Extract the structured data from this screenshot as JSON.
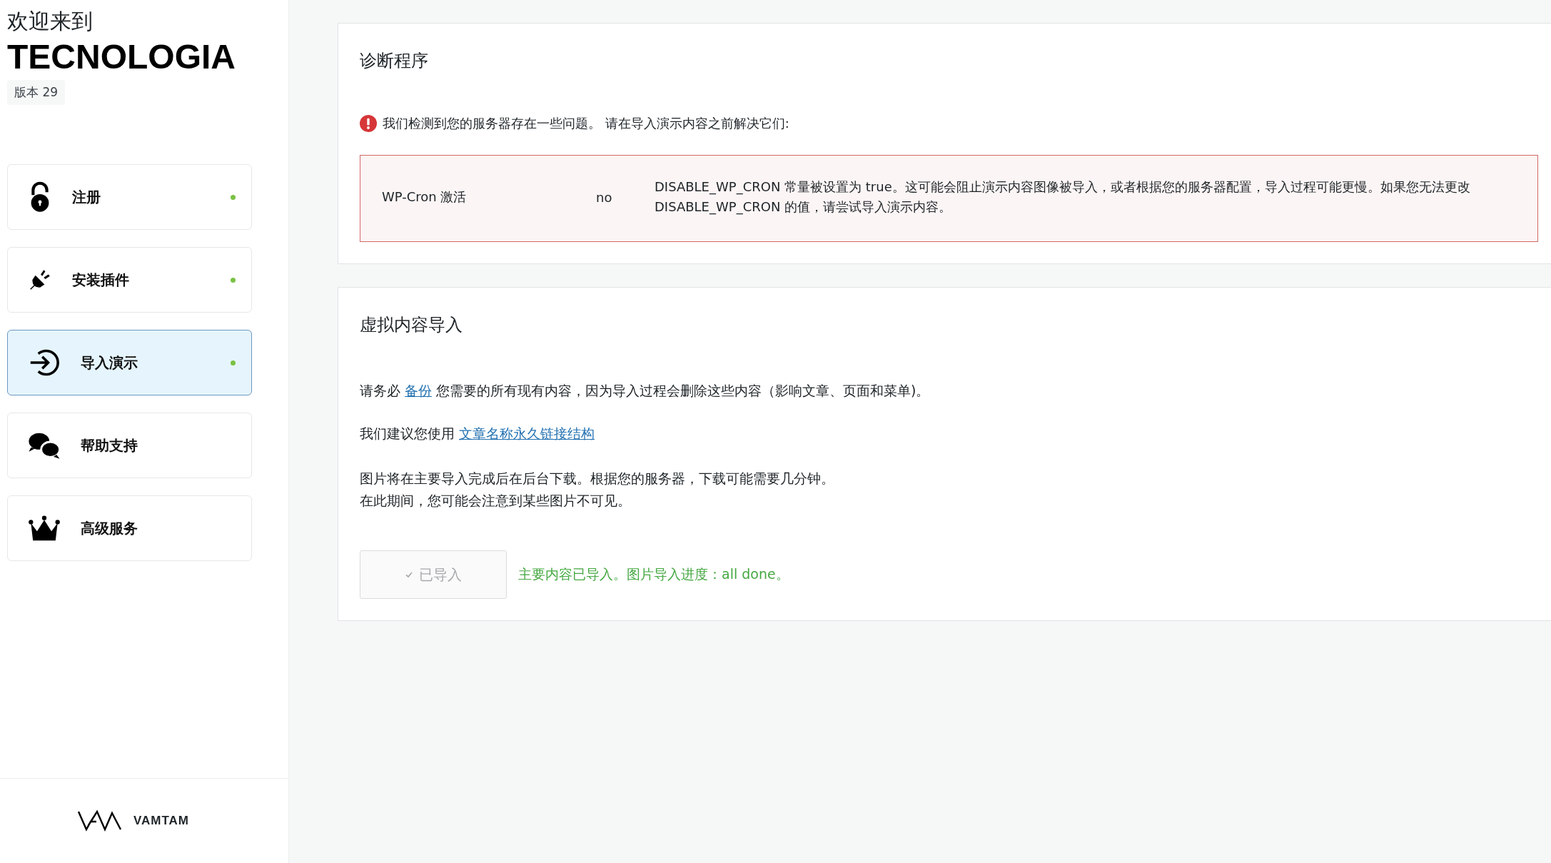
{
  "sidebar": {
    "welcome": "欢迎来到",
    "theme_name": "TECNOLOGIA",
    "version": "版本 29",
    "items": [
      {
        "label": "注册",
        "selected": false,
        "done": true
      },
      {
        "label": "安装插件",
        "selected": false,
        "done": true
      },
      {
        "label": "导入演示",
        "selected": true,
        "done": true
      },
      {
        "label": "帮助支持",
        "selected": false,
        "done": false
      },
      {
        "label": "高级服务",
        "selected": false,
        "done": false
      }
    ],
    "footer_logo": "VAMTAM"
  },
  "diagnostics": {
    "title": "诊断程序",
    "warning": "我们检测到您的服务器存在一些问题。 请在导入演示内容之前解决它们:",
    "issues": [
      {
        "name": "WP-Cron 激活",
        "value": "no",
        "description": "DISABLE_WP_CRON 常量被设置为 true。这可能会阻止演示内容图像被导入，或者根据您的服务器配置，导入过程可能更慢。如果您无法更改 DISABLE_WP_CRON 的值，请尝试导入演示内容。"
      }
    ]
  },
  "import": {
    "title": "虚拟内容导入",
    "backup": {
      "before": "请务必",
      "link": "备份",
      "after": "您需要的所有现有内容，因为导入过程会删除这些内容（影响文章、页面和菜单)。"
    },
    "permalink": {
      "before": "我们建议您使用",
      "link": "文章名称永久链接结构"
    },
    "images_note": [
      "图片将在主要导入完成后在后台下载。根据您的服务器，下载可能需要几分钟。",
      "在此期间，您可能会注意到某些图片不可见。"
    ],
    "button": {
      "label": "已导入",
      "disabled": true
    },
    "status": "主要内容已导入。图片导入进度：all done。"
  }
}
